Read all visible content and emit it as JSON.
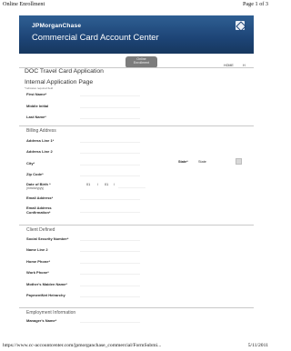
{
  "print_header": {
    "left": "Online Enrollment",
    "right": "Page 1 of 3"
  },
  "print_footer": {
    "left": "https://www.cc-accountcenter.com/jpmorganchase_commercial/FormSubmi...",
    "right": "5/11/2011"
  },
  "banner": {
    "brand": "JPMorganChase",
    "title": "Commercial Card Account Center"
  },
  "help_button": {
    "label": "Online\nEnrollment"
  },
  "nav": {
    "home": "HOME",
    "home_icon": "H"
  },
  "form": {
    "title": "DOC Travel Card Application",
    "subtitle": "Internal Application Page",
    "required_note": "*indicates required field"
  },
  "fields_personal": [
    {
      "name": "first-name",
      "label": "First Name*"
    },
    {
      "name": "middle-initial",
      "label": "Middle Initial"
    },
    {
      "name": "last-name",
      "label": "Last Name*"
    }
  ],
  "sections": {
    "billing": "Billing Address",
    "client": "Client Defined",
    "employment": "Employment Information"
  },
  "fields_billing": [
    {
      "name": "address-line-1",
      "label": "Address Line 1*"
    },
    {
      "name": "address-line-2",
      "label": "Address Line 2"
    },
    {
      "name": "city",
      "label": "City*"
    },
    {
      "name": "zip-code",
      "label": "Zip Code*"
    },
    {
      "name": "date-of-birth",
      "label": "Date of Birth *",
      "hint": "(mm/dd/yyyy)"
    },
    {
      "name": "email-address",
      "label": "Email Address*"
    },
    {
      "name": "email-address-confirm",
      "label": "Email Address",
      "label2": "Confirmation*"
    }
  ],
  "state": {
    "label": "State*",
    "value": "State"
  },
  "dob": {
    "month": "01",
    "sep1": "/",
    "day": "01",
    "sep2": "/"
  },
  "fields_client": [
    {
      "name": "social-security-number",
      "label": "Social Security Number*"
    },
    {
      "name": "name-line-2",
      "label": "Name Line 2"
    },
    {
      "name": "home-phone",
      "label": "Home Phone*"
    },
    {
      "name": "work-phone",
      "label": "Work Phone*"
    },
    {
      "name": "mothers-maiden-name",
      "label": "Mother's Maiden Name*"
    },
    {
      "name": "payment-net-hierarchy",
      "label": "PaymentNet Heirarchy"
    }
  ],
  "fields_employment": [
    {
      "name": "managers-name",
      "label": "Manager's Name*"
    }
  ]
}
